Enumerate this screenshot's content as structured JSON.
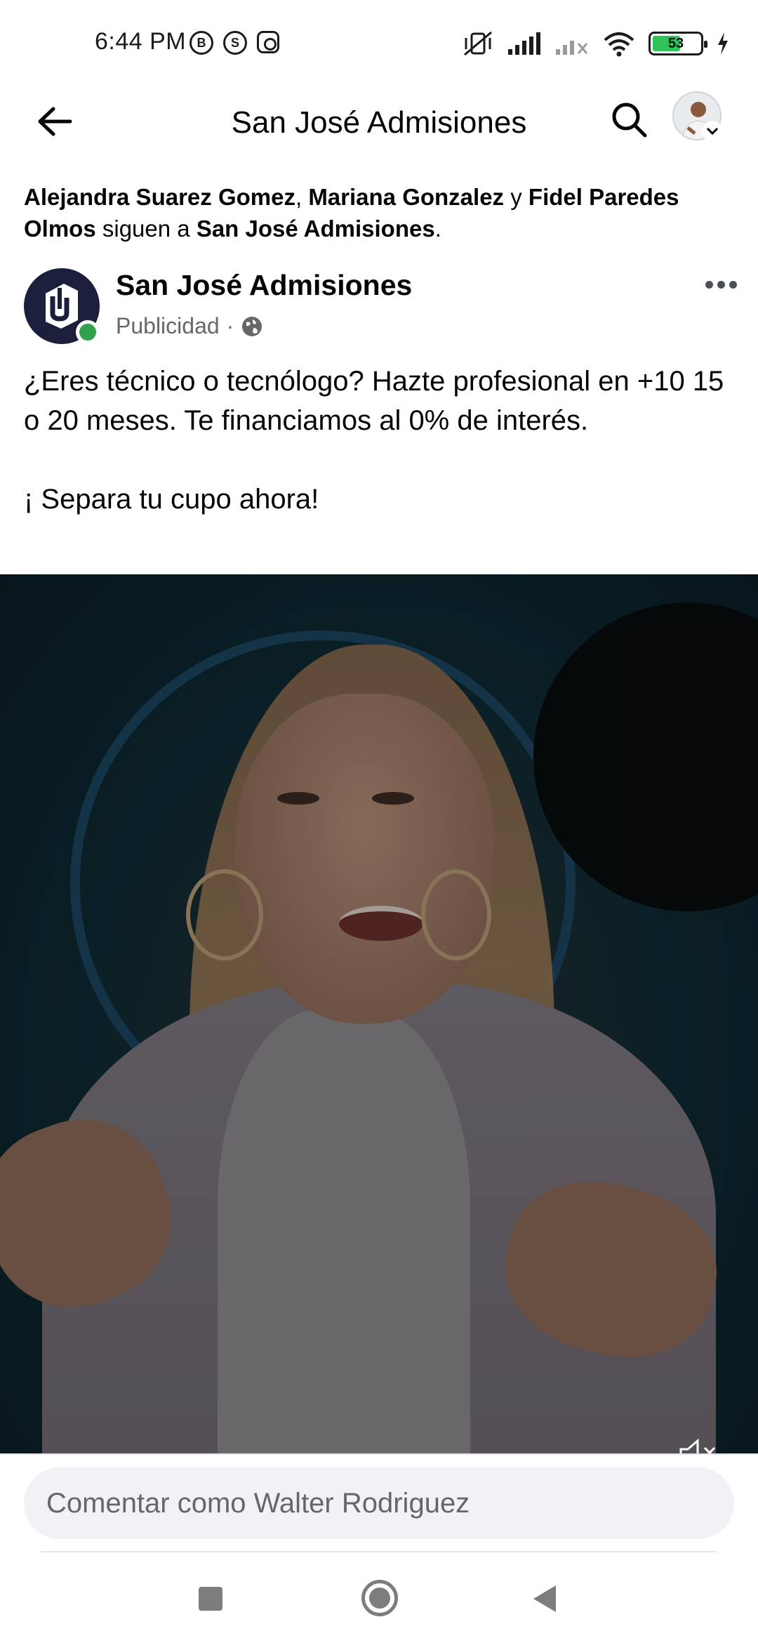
{
  "status_bar": {
    "time": "6:44 PM",
    "battery_level": "53",
    "left_icons": [
      "b-circle-icon",
      "shazam-icon",
      "instagram-icon"
    ],
    "right_icons": [
      "vibrate-mute-icon",
      "signal-icon",
      "signal-no-service-icon",
      "wifi-icon",
      "battery-icon",
      "charging-bolt-icon"
    ]
  },
  "header": {
    "title": "San José Admisiones"
  },
  "social_context": {
    "person1": "Alejandra Suarez Gomez",
    "sep1": ", ",
    "person2": "Mariana Gonzalez",
    "sep2": " y ",
    "person3": "Fidel Paredes Olmos",
    "action": " siguen a ",
    "page": "San José Admisiones",
    "end": "."
  },
  "post": {
    "author": "San José Admisiones",
    "sponsored_label": "Publicidad",
    "meta_separator": "·",
    "text": "¿Eres técnico o tecnólogo? Hazte profesional en +10 15 o 20 meses. Te financiamos al 0% de interés.\n\n¡ Separa tu cupo ahora!"
  },
  "comment_bar": {
    "placeholder": "Comentar como Walter Rodriguez"
  },
  "colors": {
    "secondary_text": "#65676b",
    "online_green": "#31a24c",
    "input_bg": "#f0f2f5",
    "logo_bg": "#1b1f3b"
  }
}
